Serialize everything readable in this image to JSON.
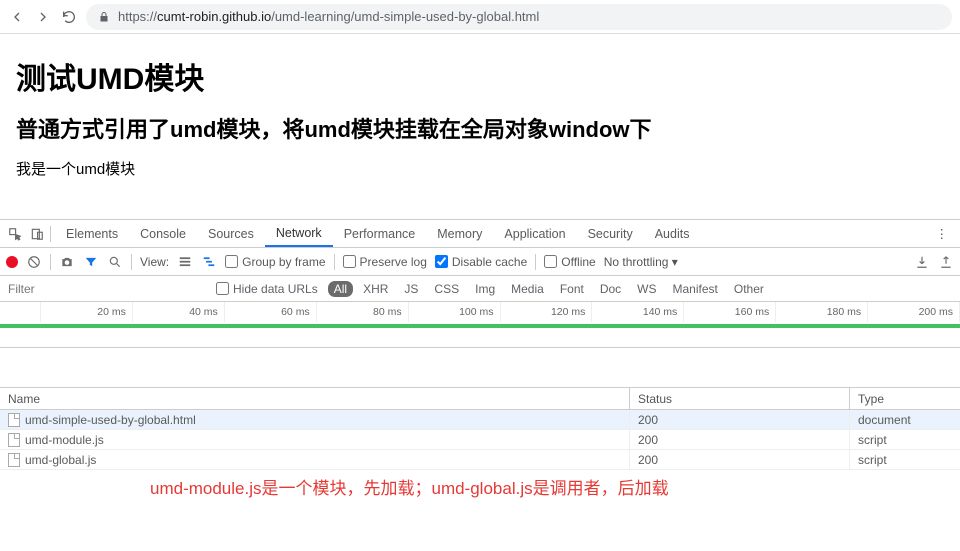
{
  "address": {
    "host": "cumt-robin.github.io",
    "path": "/umd-learning/umd-simple-used-by-global.html",
    "scheme": "https://"
  },
  "page": {
    "h1": "测试UMD模块",
    "h2": "普通方式引用了umd模块，将umd模块挂载在全局对象window下",
    "text": "我是一个umd模块"
  },
  "devtools": {
    "tabs": [
      "Elements",
      "Console",
      "Sources",
      "Network",
      "Performance",
      "Memory",
      "Application",
      "Security",
      "Audits"
    ],
    "active_tab": "Network",
    "filter_row": {
      "view_label": "View:",
      "group_by_frame": "Group by frame",
      "preserve_log": "Preserve log",
      "disable_cache": "Disable cache",
      "offline": "Offline",
      "throttling": "No throttling"
    },
    "types_row": {
      "filter_placeholder": "Filter",
      "hide_data_urls": "Hide data URLs",
      "types": [
        "All",
        "XHR",
        "JS",
        "CSS",
        "Img",
        "Media",
        "Font",
        "Doc",
        "WS",
        "Manifest",
        "Other"
      ],
      "active_type": "All"
    },
    "timeline_ticks": [
      "20 ms",
      "40 ms",
      "60 ms",
      "80 ms",
      "100 ms",
      "120 ms",
      "140 ms",
      "160 ms",
      "180 ms",
      "200 ms"
    ],
    "table": {
      "headers": [
        "Name",
        "Status",
        "Type"
      ],
      "rows": [
        {
          "name": "umd-simple-used-by-global.html",
          "status": "200",
          "type": "document",
          "sel": true
        },
        {
          "name": "umd-module.js",
          "status": "200",
          "type": "script",
          "sel": false
        },
        {
          "name": "umd-global.js",
          "status": "200",
          "type": "script",
          "sel": false
        }
      ]
    }
  },
  "annotation": "umd-module.js是一个模块，先加载；umd-global.js是调用者，后加载"
}
